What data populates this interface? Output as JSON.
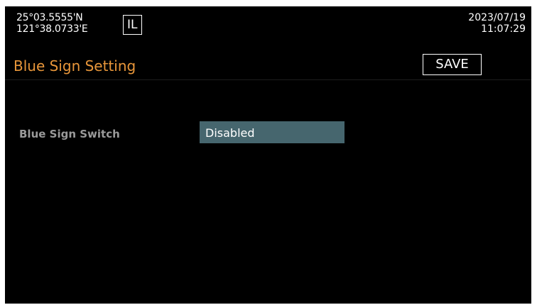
{
  "header": {
    "latitude": "25°03.5555'N",
    "longitude": "121°38.0733'E",
    "mode_badge": "IL",
    "date": "2023/07/19",
    "time": "11:07:29"
  },
  "page": {
    "title": "Blue Sign Setting",
    "save_label": "SAVE"
  },
  "settings": [
    {
      "label": "Blue Sign Switch",
      "value": "Disabled"
    }
  ],
  "colors": {
    "background": "#000000",
    "title": "#e8963a",
    "label": "#9a9a9a",
    "selected_field": "#46666e"
  }
}
